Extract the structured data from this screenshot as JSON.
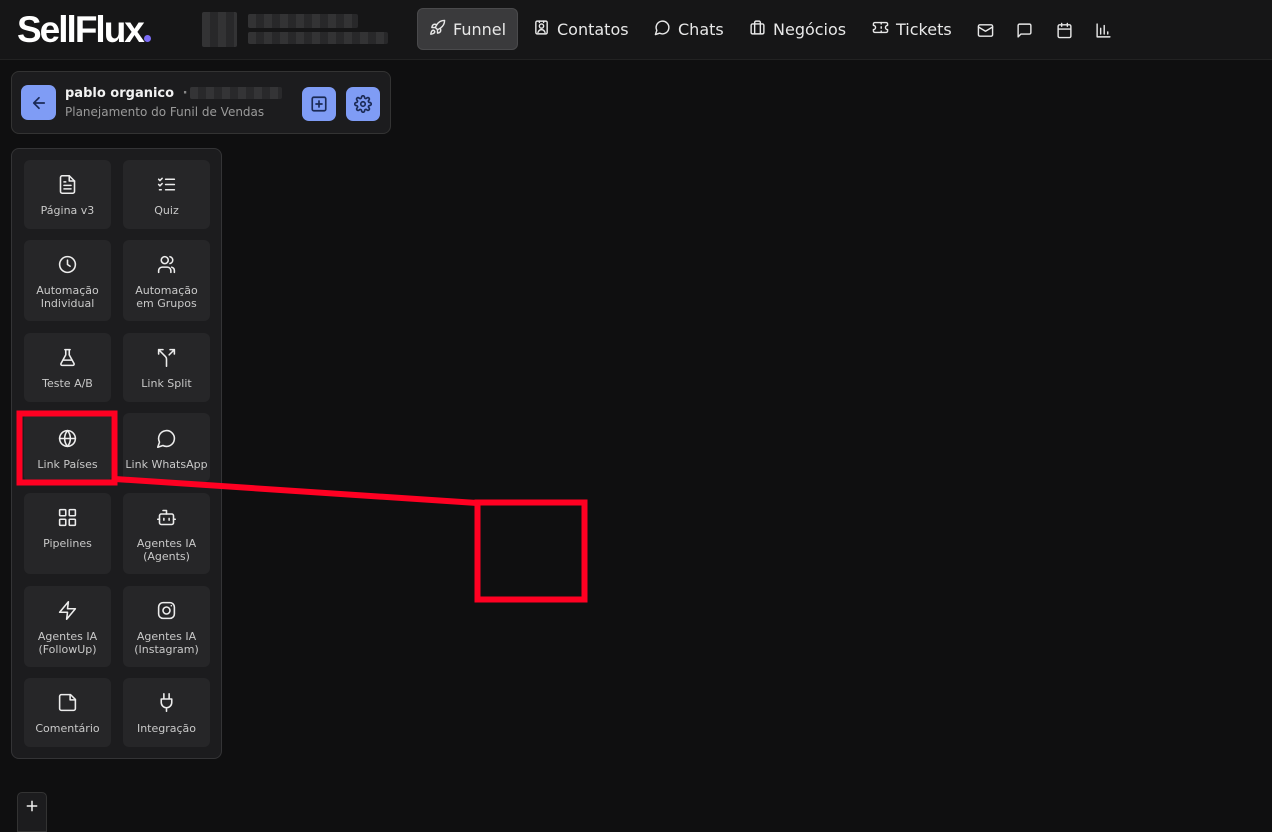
{
  "brand": {
    "logo": "SellFlux"
  },
  "nav": [
    {
      "label": "Funnel",
      "icon": "rocket-icon",
      "active": true
    },
    {
      "label": "Contatos",
      "icon": "contact-icon"
    },
    {
      "label": "Chats",
      "icon": "chat-icon"
    },
    {
      "label": "Negócios",
      "icon": "briefcase-icon"
    },
    {
      "label": "Tickets",
      "icon": "ticket-icon"
    }
  ],
  "project": {
    "name": "pablo organico",
    "separator": "·",
    "subtitle": "Planejamento do Funil de Vendas"
  },
  "palette": [
    {
      "label": "Página v3",
      "icon": "file-text-icon"
    },
    {
      "label": "Quiz",
      "icon": "checklist-icon"
    },
    {
      "label": "Automação Individual",
      "icon": "clock-icon"
    },
    {
      "label": "Automação em Grupos",
      "icon": "users-icon"
    },
    {
      "label": "Teste A/B",
      "icon": "flask-icon"
    },
    {
      "label": "Link Split",
      "icon": "split-icon"
    },
    {
      "label": "Link Países",
      "icon": "globe-icon"
    },
    {
      "label": "Link WhatsApp",
      "icon": "whatsapp-icon"
    },
    {
      "label": "Pipelines",
      "icon": "grid-icon"
    },
    {
      "label": "Agentes IA (Agents)",
      "icon": "bot-icon"
    },
    {
      "label": "Agentes IA (FollowUp)",
      "icon": "zap-icon"
    },
    {
      "label": "Agentes IA (Instagram)",
      "icon": "instagram-icon"
    },
    {
      "label": "Comentário",
      "icon": "sticky-note-icon"
    },
    {
      "label": "Integração",
      "icon": "plug-icon"
    }
  ],
  "colors": {
    "accent": "#7f9cf5",
    "annotation": "#ff0022",
    "background": "#0f0f10"
  }
}
